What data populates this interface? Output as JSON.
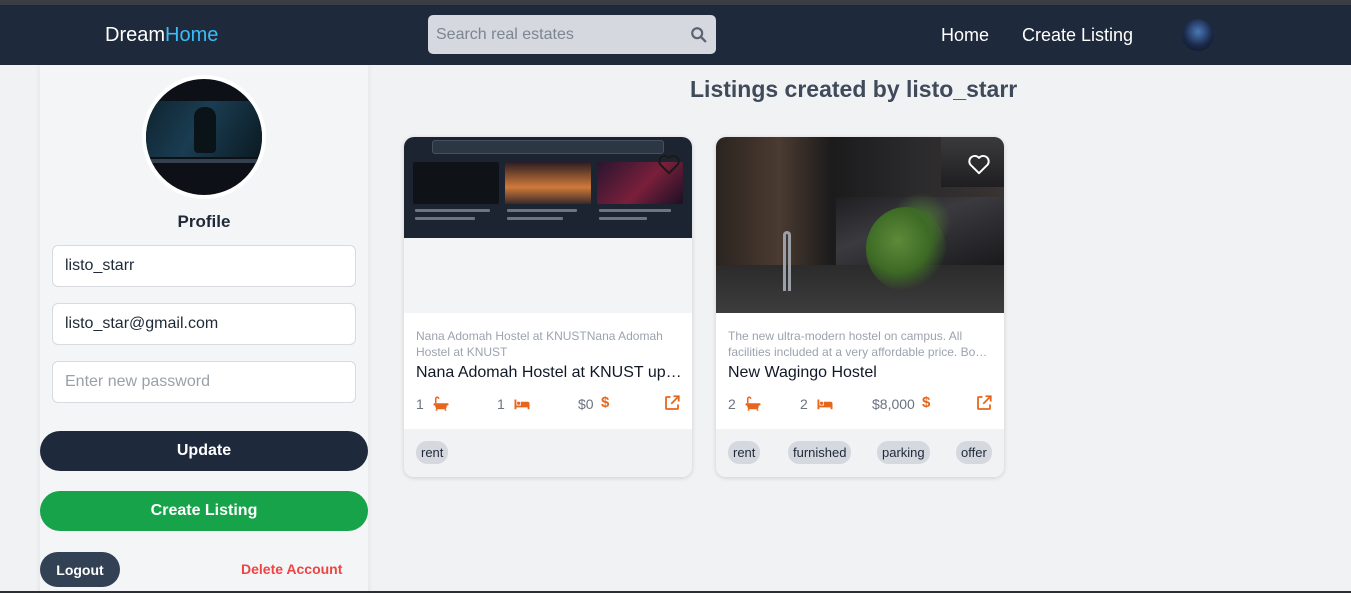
{
  "app": {
    "brand_primary": "Dream",
    "brand_accent": "Home",
    "brand_accent_color": "#38bdf8"
  },
  "nav": {
    "search_placeholder": "Search real estates",
    "links": [
      "Home",
      "Create Listing"
    ]
  },
  "profile": {
    "heading": "Profile",
    "username_value": "listo_starr",
    "email_value": "listo_star@gmail.com",
    "password_placeholder": "Enter new password",
    "update_label": "Update",
    "create_listing_label": "Create Listing",
    "logout_label": "Logout",
    "delete_label": "Delete Account"
  },
  "listings": {
    "heading": "Listings created by listo_starr",
    "items": [
      {
        "description": "Nana Adomah Hostel at KNUSTNana Adomah Hostel at KNUST",
        "name": "Nana Adomah Hostel at KNUST updated",
        "baths": "1",
        "beds": "1",
        "price": "$0",
        "currency_icon": "$",
        "tags": [
          "rent"
        ]
      },
      {
        "description": "The new ultra-modern hostel on campus. All facilities included at a very affordable price. Book now",
        "name": "New Wagingo Hostel",
        "baths": "2",
        "beds": "2",
        "price": "$8,000",
        "currency_icon": "$",
        "tags": [
          "rent",
          "furnished",
          "parking",
          "offer"
        ]
      }
    ]
  },
  "colors": {
    "navbar": "#1e293b",
    "accent_orange": "#e8661c",
    "update_button": "#1e293b",
    "create_button": "#16a34a",
    "delete_text": "#ef4444"
  },
  "icons": {
    "search": "search-icon",
    "bath": "bathtub-icon",
    "bed": "bed-icon",
    "external": "external-link-icon",
    "favorite": "heart-icon"
  }
}
